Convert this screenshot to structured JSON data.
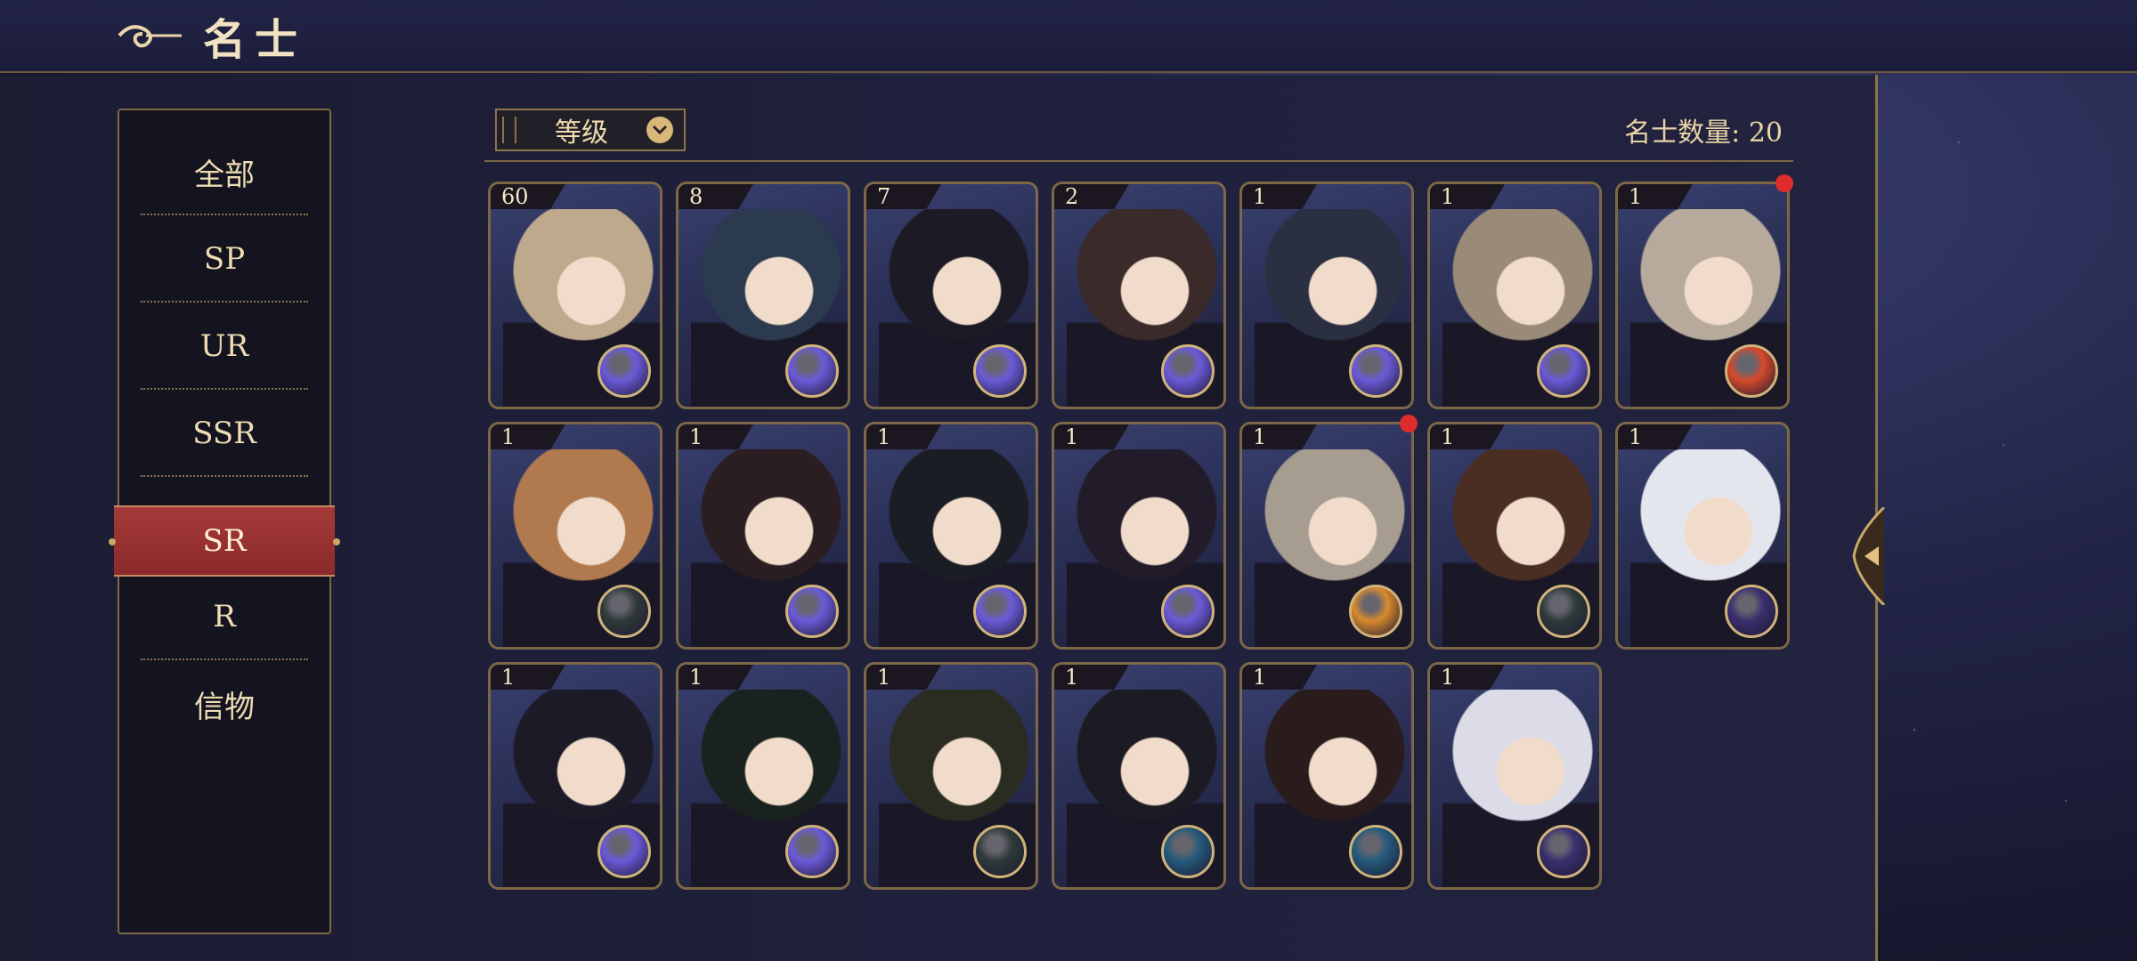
{
  "header": {
    "title": "名士"
  },
  "tabs": [
    {
      "label": "全部",
      "active": false
    },
    {
      "label": "SP",
      "active": false
    },
    {
      "label": "UR",
      "active": false
    },
    {
      "label": "SSR",
      "active": false
    },
    {
      "label": "SR",
      "active": true
    },
    {
      "label": "R",
      "active": false
    },
    {
      "label": "信物",
      "active": false
    }
  ],
  "sort": {
    "label": "等级"
  },
  "count_text": "名士数量: 20",
  "cards": [
    {
      "level": "60",
      "badge": "purple-orb",
      "hair": "#bfa98c",
      "notify": false
    },
    {
      "level": "8",
      "badge": "purple-orb",
      "hair": "#2b3a4e",
      "notify": false
    },
    {
      "level": "7",
      "badge": "purple-orb",
      "hair": "#1c1a24",
      "notify": false
    },
    {
      "level": "2",
      "badge": "purple-orb",
      "hair": "#3a2a2a",
      "notify": false
    },
    {
      "level": "1",
      "badge": "purple-orb",
      "hair": "#2a3042",
      "notify": false
    },
    {
      "level": "1",
      "badge": "purple-orb",
      "hair": "#9a8a78",
      "notify": false
    },
    {
      "level": "1",
      "badge": "red-orb",
      "hair": "#b7aa9c",
      "notify": true
    },
    {
      "level": "1",
      "badge": "compass",
      "hair": "#b07a4e",
      "notify": false
    },
    {
      "level": "1",
      "badge": "purple-orb",
      "hair": "#2b1e22",
      "notify": false
    },
    {
      "level": "1",
      "badge": "purple-orb",
      "hair": "#1a1d24",
      "notify": false
    },
    {
      "level": "1",
      "badge": "purple-orb",
      "hair": "#221c2a",
      "notify": false
    },
    {
      "level": "1",
      "badge": "orange-orb",
      "hair": "#a79c90",
      "notify": true
    },
    {
      "level": "1",
      "badge": "compass",
      "hair": "#4a2e24",
      "notify": false
    },
    {
      "level": "1",
      "badge": "planet",
      "hair": "#e4e6ee",
      "notify": false
    },
    {
      "level": "1",
      "badge": "purple-orb",
      "hair": "#1d1a28",
      "notify": false
    },
    {
      "level": "1",
      "badge": "purple-orb",
      "hair": "#1a2220",
      "notify": false
    },
    {
      "level": "1",
      "badge": "compass",
      "hair": "#2a2c22",
      "notify": false
    },
    {
      "level": "1",
      "badge": "blue-compass",
      "hair": "#1c1a22",
      "notify": false
    },
    {
      "level": "1",
      "badge": "blue-compass",
      "hair": "#2a1c1c",
      "notify": false
    },
    {
      "level": "1",
      "badge": "planet",
      "hair": "#dcdce8",
      "notify": false
    }
  ],
  "colors": {
    "accent_gold": "#e6cf9e",
    "active_tab": "#9a3231",
    "notify_red": "#e02b2b",
    "purple_orb": "#6b5ad8",
    "red_orb": "#d64a2a",
    "orange_orb": "#d98a2e",
    "compass": "#2f3a3a",
    "blue_compass": "#245a7c",
    "planet": "#3a2f6e"
  }
}
